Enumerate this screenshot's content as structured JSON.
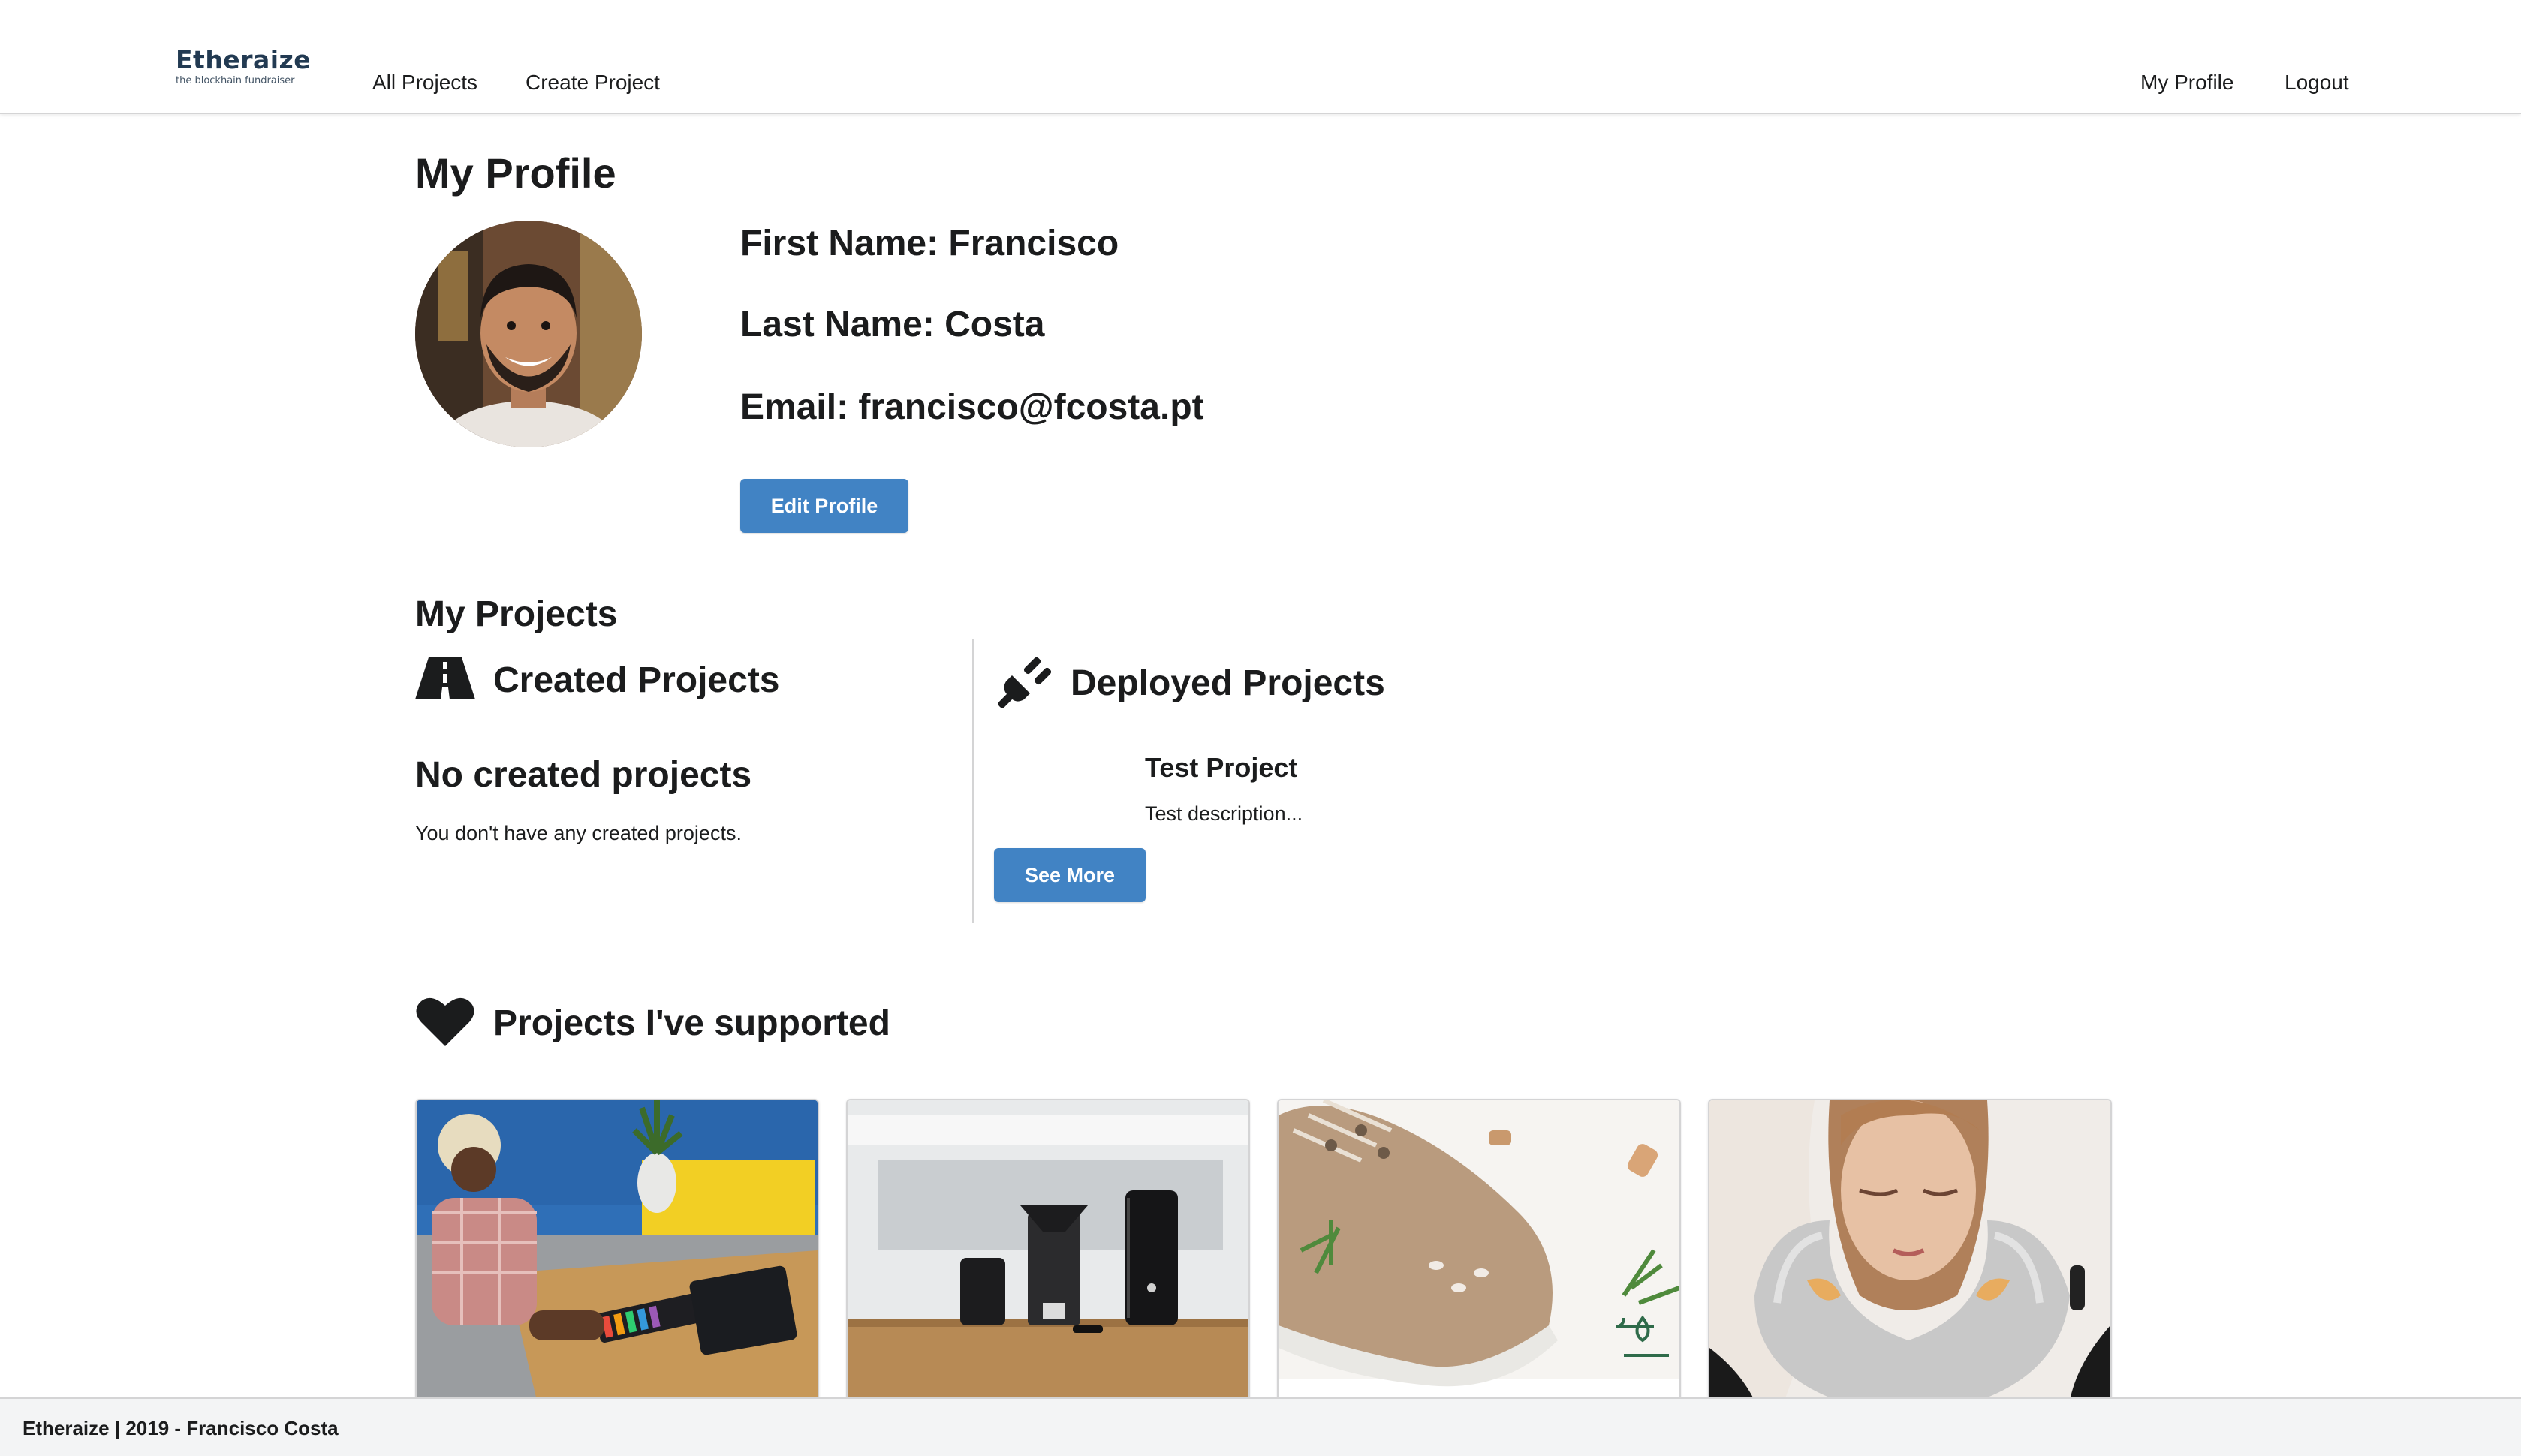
{
  "nav": {
    "logo_word": "Etheraize",
    "logo_tagline": "the blockhain fundraiser",
    "links_left": [
      "All Projects",
      "Create Project"
    ],
    "links_right": [
      "My Profile",
      "Logout"
    ]
  },
  "profile": {
    "heading": "My Profile",
    "first_name": "First Name: Francisco",
    "last_name": "Last Name: Costa",
    "email": "Email: francisco@fcosta.pt",
    "edit_button": "Edit Profile"
  },
  "projects": {
    "heading": "My Projects",
    "created": {
      "title": "Created Projects",
      "empty_title": "No created projects",
      "empty_text": "You don't have any created projects."
    },
    "deployed": {
      "title": "Deployed Projects",
      "items": [
        {
          "name": "Test Project",
          "description": "Test description...",
          "button": "See More"
        }
      ]
    }
  },
  "supported": {
    "title": "Projects I've supported",
    "cards": [
      {
        "image": "person-playing-keyboard-photo"
      },
      {
        "image": "coffee-grinder-photo"
      },
      {
        "image": "sneaker-photo"
      },
      {
        "image": "neck-pillow-photo"
      }
    ]
  },
  "footer": {
    "text": "Etheraize | 2019 - Francisco Costa"
  },
  "colors": {
    "primary_button": "#4183c4",
    "footer_bg": "#f3f4f5",
    "text": "#1b1c1d"
  }
}
